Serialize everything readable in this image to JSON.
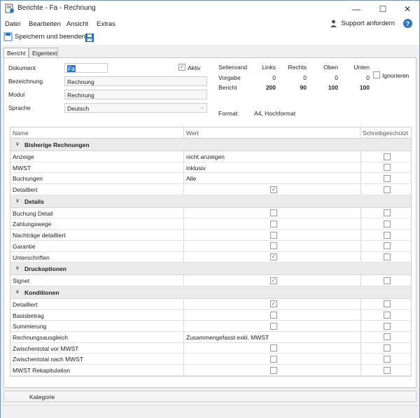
{
  "window": {
    "title": "Berichte - Fa - Rechnung"
  },
  "menu": {
    "items": [
      "Datei",
      "Bearbeiten",
      "Ansicht",
      "Extras"
    ],
    "support": "Support anfordern"
  },
  "toolbar": {
    "save_label": "Speichern und beenden"
  },
  "tabs": [
    "Bericht",
    "Eigentext"
  ],
  "form": {
    "dokument_label": "Dokument",
    "dokument_value": "Fa",
    "aktiv_label": "Aktiv",
    "bezeichnung_label": "Bezeichnung",
    "bezeichnung_value": "Rechnung",
    "modul_label": "Modul",
    "modul_value": "Rechnung",
    "sprache_label": "Sprache",
    "sprache_value": "Deutsch"
  },
  "margins": {
    "title": "Seitenrand",
    "cols": [
      "Links",
      "Rechts",
      "Oben",
      "Unten"
    ],
    "vorgabe_label": "Vorgabe",
    "vorgabe": [
      "0",
      "0",
      "0",
      "0"
    ],
    "bericht_label": "Bericht",
    "bericht": [
      "200",
      "90",
      "100",
      "100"
    ],
    "ignore_label": "Ignorieren",
    "format_label": "Format:",
    "format_value": "A4, Hochformat"
  },
  "grid": {
    "headers": [
      "Name",
      "Wert",
      "Schreibgeschützt"
    ],
    "rows": [
      {
        "group": "Bisherige Rechnungen"
      },
      {
        "name": "Anzeige",
        "value": "nicht anzeigen"
      },
      {
        "name": "MWST",
        "value": "inklusiv"
      },
      {
        "name": "Buchungen",
        "value": "Alle"
      },
      {
        "name": "Detailliert",
        "check": true
      },
      {
        "group": "Details"
      },
      {
        "name": "Buchung Detail",
        "check": false
      },
      {
        "name": "Zahlungswege",
        "check": false
      },
      {
        "name": "Nachträge detailliert",
        "check": false
      },
      {
        "name": "Garantie",
        "check": false
      },
      {
        "name": "Unterschriften",
        "check": true
      },
      {
        "group": "Druckoptionen"
      },
      {
        "name": "Signet",
        "check": true
      },
      {
        "group": "Konditionen"
      },
      {
        "name": "Detailliert",
        "check": true
      },
      {
        "name": "Basisbetrag",
        "check": false
      },
      {
        "name": "Summierung",
        "check": false
      },
      {
        "name": "Rechnungsausgleich",
        "value": "Zusammengefasst exkl. MWST"
      },
      {
        "name": "Zwischentotal vor MWST",
        "check": false
      },
      {
        "name": "Zwischentotal nach MWST",
        "check": false
      },
      {
        "name": "MWST Rekapitulation",
        "check": false
      }
    ]
  },
  "footer": {
    "kategorie": "Kategorie"
  },
  "colors": {
    "accent": "#2b78c5"
  },
  "icons": [
    "report-icon",
    "minimize-icon",
    "maximize-icon",
    "close-icon",
    "support-icon",
    "help-icon",
    "save-icon",
    "disk-icon",
    "chevron-down-icon",
    "checkbox-icon"
  ]
}
